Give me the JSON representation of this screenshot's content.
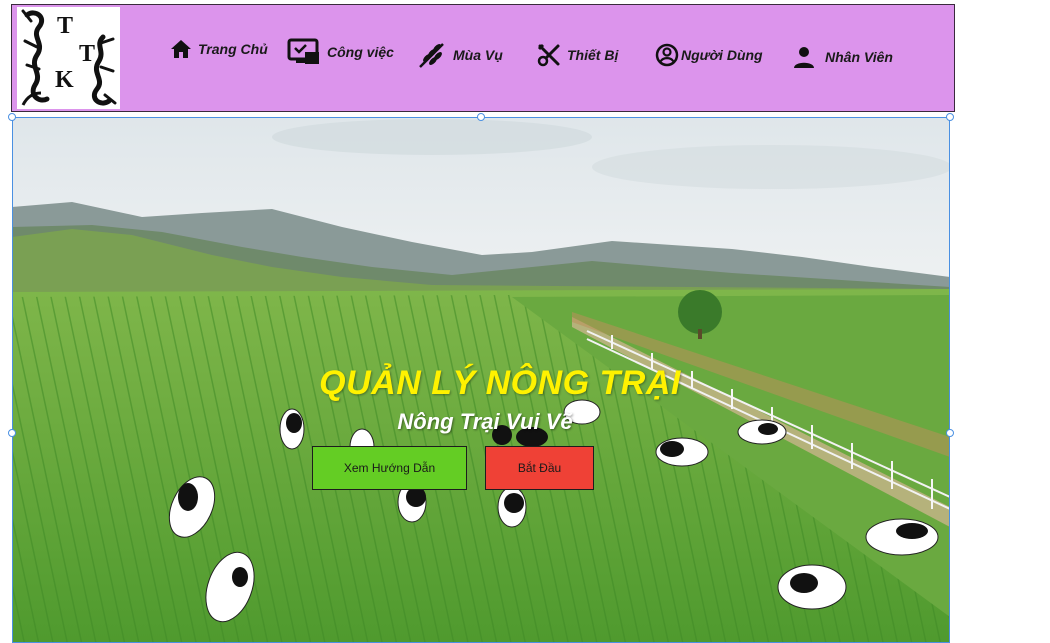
{
  "header": {
    "logo_text": "TTK",
    "nav": [
      {
        "label": "Trang Chủ",
        "icon": "home-icon"
      },
      {
        "label": "Công việc",
        "icon": "task-screen-icon"
      },
      {
        "label": "Mùa Vụ",
        "icon": "wheat-icon"
      },
      {
        "label": "Thiết Bị",
        "icon": "tools-icon"
      },
      {
        "label": "Người Dùng",
        "icon": "user-circle-icon"
      },
      {
        "label": "Nhân Viên",
        "icon": "person-icon"
      }
    ]
  },
  "hero": {
    "title": "QUẢN LÝ NÔNG TRẠI",
    "subtitle": "Nông Trại Vui Vẽ",
    "buttons": {
      "guide": "Xem Hướng Dẫn",
      "start": "Bắt Đầu"
    }
  },
  "colors": {
    "header_bg": "#dc94ec",
    "title": "#fff200",
    "guide_button": "#64cd24",
    "start_button": "#ef4136",
    "selection": "#4a90e2"
  }
}
